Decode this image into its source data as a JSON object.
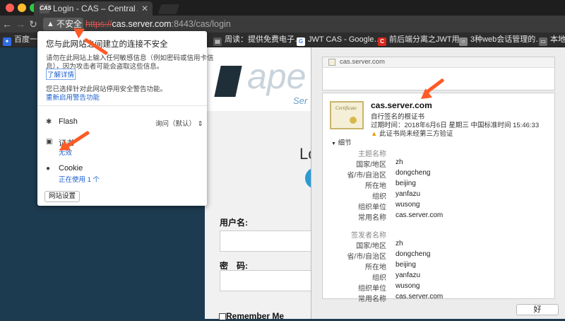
{
  "window": {
    "tab_title": "Login - CAS – Central Authent",
    "tab_favicon_text": "CAS"
  },
  "toolbar": {
    "security_label": "不安全",
    "url_scheme": "https://",
    "url_host": "cas.server.com",
    "url_rest": ":8443/cas/login"
  },
  "bookmarks": [
    {
      "label": "百度一下",
      "icon_color": "#2f6ce5"
    },
    {
      "label": "周读：提供免费电子…",
      "icon_color": "#555555"
    },
    {
      "label": "JWT CAS - Google…",
      "icon_color": "#ffffff"
    },
    {
      "label": "前后端分离之JWT用…",
      "icon_color": "#d9261c"
    },
    {
      "label": "3种web会话管理的…",
      "icon_color": "#888888"
    },
    {
      "label": "本地",
      "icon_color": "#666666"
    }
  ],
  "popup": {
    "heading": "您与此网站之间建立的连接不安全",
    "desc_line1": "请勿在此网站上输入任何敏感信息（例如密码或信用卡信",
    "desc_line2": "息），因为攻击者可能会盗取这些信息。",
    "learn_more": "了解详情",
    "warning_disabled": "您已选择针对此网站停用安全警告功能。",
    "reenable": "重新启用警告功能",
    "flash_label": "Flash",
    "flash_value": "询问（默认）",
    "cert_label": "证书",
    "cert_status": "无效",
    "cookie_label": "Cookie",
    "cookie_status": "正在使用 1 个",
    "site_settings": "网站设置"
  },
  "login": {
    "logo_text": "ape",
    "logo_sub": "Ser",
    "heading": "Lo",
    "username_label": "用户名:",
    "password_label": "密　码:",
    "remember": "Remember Me"
  },
  "cert": {
    "header_host": "cas.server.com",
    "common_name": "cas.server.com",
    "self_signed": "自行签名的根证书",
    "expiry": "过期时间：2018年6月6日 星期三 中国标准时间 15:46:33",
    "untrusted": "此证书尚未经第三方验证",
    "details_toggle": "细节",
    "subject_title": "主题名称",
    "issuer_title": "签发者名称",
    "subject_rows": [
      {
        "k": "国家/地区",
        "v": "zh"
      },
      {
        "k": "省/市/自治区",
        "v": "dongcheng"
      },
      {
        "k": "所在地",
        "v": "beijing"
      },
      {
        "k": "组织",
        "v": "yanfazu"
      },
      {
        "k": "组织单位",
        "v": "wusong"
      },
      {
        "k": "常用名称",
        "v": "cas.server.com"
      }
    ],
    "issuer_rows": [
      {
        "k": "国家/地区",
        "v": "zh"
      },
      {
        "k": "省/市/自治区",
        "v": "dongcheng"
      },
      {
        "k": "所在地",
        "v": "beijing"
      },
      {
        "k": "组织",
        "v": "yanfazu"
      },
      {
        "k": "组织单位",
        "v": "wusong"
      },
      {
        "k": "常用名称",
        "v": "cas.server.com"
      }
    ],
    "ok_button": "好"
  },
  "colors": {
    "annotation_arrow": "#ff5a26",
    "page_background": "#1d3b50",
    "link": "#1a5fcf"
  }
}
